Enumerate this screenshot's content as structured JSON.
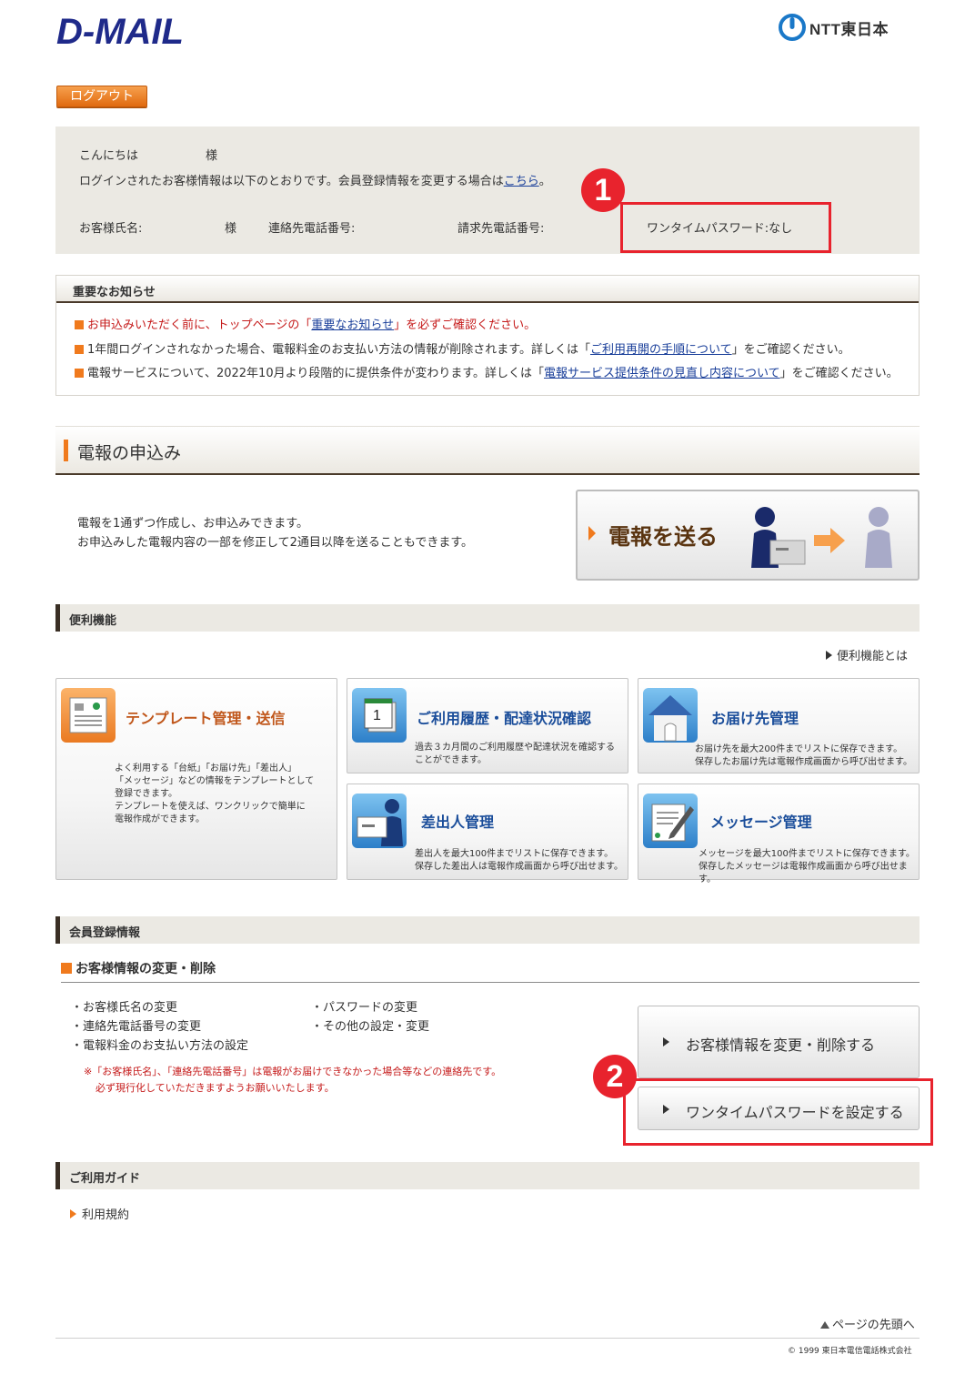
{
  "header": {
    "logo_text": "D-MAIL",
    "company_logo": "NTT東日本",
    "logout_label": "ログアウト"
  },
  "greeting": {
    "hello": "こんにちは",
    "sama1": "様",
    "info_text": "ログインされたお客様情報は以下のとおりです。会員登録情報を変更する場合は",
    "info_link": "こちら",
    "info_end": "。",
    "name_label": "お客様氏名:",
    "sama2": "様",
    "contact_label": "連絡先電話番号:",
    "billing_label": "請求先電話番号:",
    "otp_status": "ワンタイムパスワード:なし",
    "badge1": "1"
  },
  "notice": {
    "title": "重要なお知らせ",
    "item1_pre": "お申込みいただく前に、トップページの「",
    "item1_link": "重要なお知らせ",
    "item1_post": "」を必ずご確認ください。",
    "item2_pre": "1年間ログインされなかった場合、電報料金のお支払い方法の情報が削除されます。詳しくは「",
    "item2_link": "ご利用再開の手順について",
    "item2_post": "」をご確認ください。",
    "item3_pre": "電報サービスについて、2022年10月より段階的に提供条件が変わります。詳しくは「",
    "item3_link": "電報サービス提供条件の見直し内容について",
    "item3_post": "」をご確認ください。"
  },
  "telegram": {
    "title": "電報の申込み",
    "desc1": "電報を1通ずつ作成し、お申込みできます。",
    "desc2": "お申込みした電報内容の一部を修正して2通目以降を送ることもできます。",
    "send_label": "電報を送る"
  },
  "features": {
    "title": "便利機能",
    "about_link": "便利機能とは",
    "cards": [
      {
        "title": "テンプレート管理・送信",
        "icon": "template-icon",
        "desc": [
          "よく利用する「台紙」「お届け先」「差出人」",
          "「メッセージ」などの情報をテンプレートとして",
          "登録できます。",
          "テンプレートを使えば、ワンクリックで簡単に",
          "電報作成ができます。"
        ]
      },
      {
        "title": "ご利用履歴・配達状況確認",
        "icon": "calendar-icon",
        "desc": [
          "過去３カ月間のご利用履歴や配達状況を確認する",
          "ことができます。"
        ]
      },
      {
        "title": "お届け先管理",
        "icon": "house-icon",
        "desc": [
          "お届け先を最大200件までリストに保存できます。",
          "保存したお届け先は電報作成画面から呼び出せます。"
        ]
      },
      {
        "title": "差出人管理",
        "icon": "sender-icon",
        "desc": [
          "差出人を最大100件までリストに保存できます。",
          "保存した差出人は電報作成画面から呼び出せます。"
        ]
      },
      {
        "title": "メッセージ管理",
        "icon": "message-icon",
        "desc": [
          "メッセージを最大100件までリストに保存できます。",
          "保存したメッセージは電報作成画面から呼び出せます。"
        ]
      }
    ]
  },
  "member": {
    "title": "会員登録情報",
    "subtitle": "お客様情報の変更・削除",
    "items_left": [
      "・お客様氏名の変更",
      "・連絡先電話番号の変更",
      "・電報料金のお支払い方法の設定"
    ],
    "items_right": [
      "・パスワードの変更",
      "・その他の設定・変更"
    ],
    "note1": "※「お客様氏名」、「連絡先電話番号」は電報がお届けできなかった場合等などの連絡先です。",
    "note2": "必ず現行化していただきますようお願いいたします。",
    "change_btn": "お客様情報を変更・削除する",
    "otp_btn": "ワンタイムパスワードを設定する",
    "badge2": "2"
  },
  "guide": {
    "title": "ご利用ガイド",
    "terms": "利用規約"
  },
  "footer": {
    "page_top": "ページの先頭へ",
    "copyright": "© 1999 東日本電信電話株式会社"
  },
  "colors": {
    "accent_orange": "#f07a1d",
    "highlight_red": "#e8232d",
    "title_blue": "#1a4d9a",
    "dark_brown": "#3a2f25"
  }
}
